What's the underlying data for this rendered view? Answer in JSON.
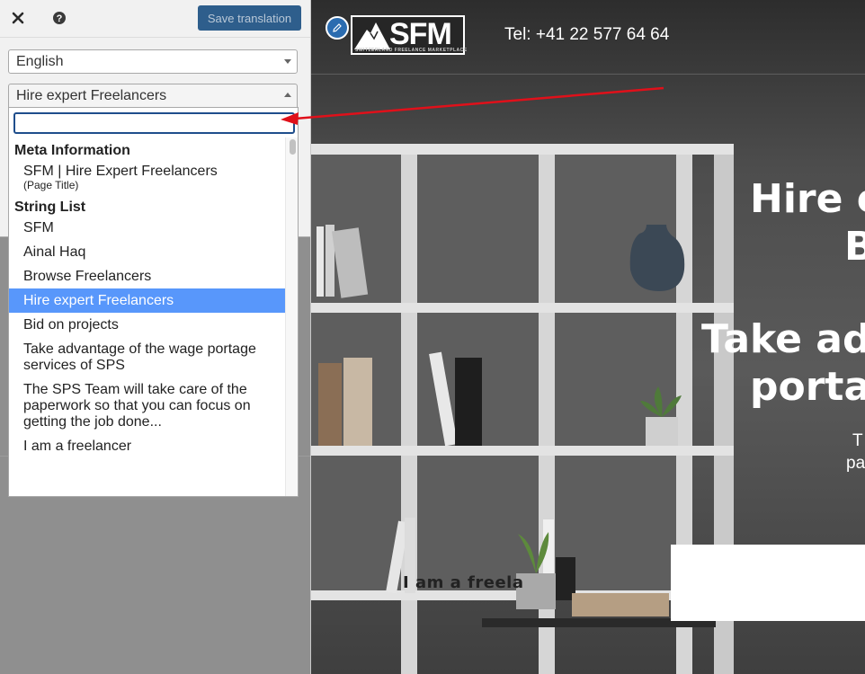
{
  "toolbar": {
    "close_icon": "close-icon",
    "help_icon": "help-icon",
    "save_label": "Save translation"
  },
  "language_select": {
    "value": "English"
  },
  "string_select": {
    "value": "Hire expert Freelancers"
  },
  "dropdown": {
    "search_value": "",
    "groups": [
      {
        "label": "Meta Information",
        "items": [
          {
            "label": "SFM | Hire Expert Freelancers",
            "sub": "(Page Title)"
          }
        ]
      },
      {
        "label": "String List",
        "items": [
          {
            "label": "SFM"
          },
          {
            "label": "Ainal Haq"
          },
          {
            "label": "Browse Freelancers"
          },
          {
            "label": "Hire expert Freelancers",
            "selected": true
          },
          {
            "label": "Bid on projects"
          },
          {
            "label": "Take advantage of the wage portage services of SPS"
          },
          {
            "label": "The SPS Team will take care of the paperwork so that you can focus on getting the job done..."
          },
          {
            "label": "I am a freelancer"
          }
        ]
      }
    ]
  },
  "preview": {
    "logo_text": "SFM",
    "logo_tagline": "SWITZERLAND FREELANCE MARKETPLACE",
    "phone": "Tel: +41 22 577 64 64",
    "hero_line_1": "Hire e",
    "hero_line_2": "B",
    "hero_line_3": "Take ad",
    "hero_line_4": "porta",
    "hero_small_1": "T",
    "hero_small_2": "pa",
    "cta_label": "I am a freela"
  },
  "colors": {
    "save_button_bg": "#2e5e8c",
    "selected_option_bg": "#5897fb",
    "annotation_arrow": "#e0101a"
  }
}
